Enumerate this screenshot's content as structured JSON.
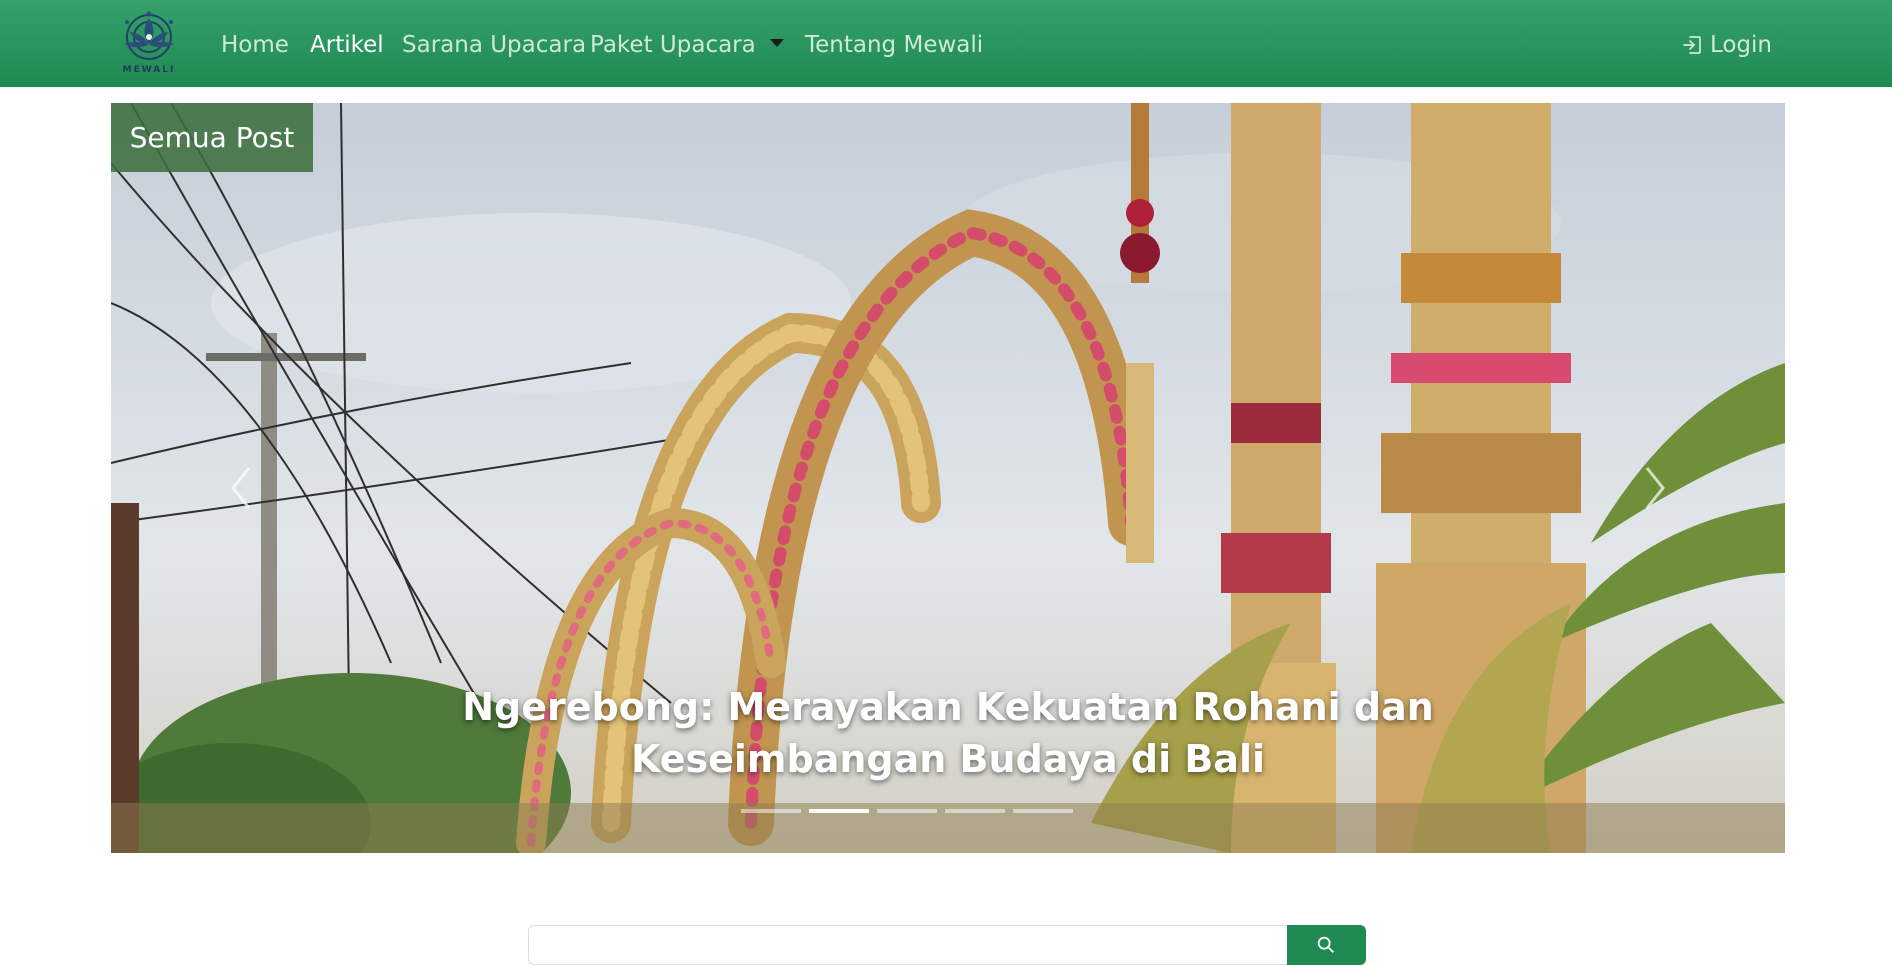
{
  "brand": {
    "name": "MEWALI",
    "logo_icon": "lotus-mandala-icon"
  },
  "nav": {
    "items": [
      {
        "label": "Home",
        "active": false
      },
      {
        "label": "Artikel",
        "active": true
      },
      {
        "label": "Sarana Upacara",
        "active": false
      },
      {
        "label": "Paket Upacara",
        "active": false,
        "dropdown": true
      },
      {
        "label": "Tentang Mewali",
        "active": false
      }
    ],
    "login_label": "Login",
    "login_icon": "sign-in-icon"
  },
  "carousel": {
    "badge": "Semua Post",
    "caption": "Ngerebong: Merayakan Kekuatan Rohani dan Keseimbangan Budaya di Bali",
    "prev_icon": "chevron-left-icon",
    "next_icon": "chevron-right-icon",
    "slide_count": 5,
    "active_slide": 1
  },
  "search": {
    "placeholder": "",
    "button_icon": "search-icon"
  },
  "colors": {
    "navbar": "#2e9a62",
    "badge": "#3c6e3c",
    "search_button": "#1e8a52"
  }
}
